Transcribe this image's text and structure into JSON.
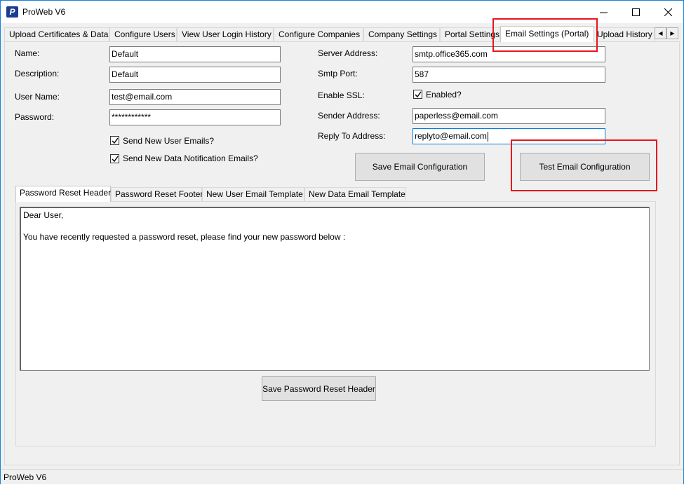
{
  "window": {
    "title": "ProWeb V6",
    "icon": "proweb-logo-icon"
  },
  "tabs": [
    {
      "label": "Upload Certificates & Data"
    },
    {
      "label": "Configure Users"
    },
    {
      "label": "View User Login History"
    },
    {
      "label": "Configure Companies"
    },
    {
      "label": "Company Settings"
    },
    {
      "label": "Portal Settings"
    },
    {
      "label": "Email Settings (Portal)"
    },
    {
      "label": "Upload History"
    }
  ],
  "form_left": {
    "name_label": "Name:",
    "name_value": "Default",
    "description_label": "Description:",
    "description_value": "Default",
    "username_label": "User Name:",
    "username_value": "test@email.com",
    "password_label": "Password:",
    "password_value": "************",
    "send_new_user_label": "Send New User Emails?",
    "send_new_data_label": "Send New Data Notification Emails?"
  },
  "form_right": {
    "server_label": "Server Address:",
    "server_value": "smtp.office365.com",
    "port_label": "Smtp Port:",
    "port_value": "587",
    "ssl_label": "Enable SSL:",
    "ssl_checkbox_label": "Enabled?",
    "sender_label": "Sender Address:",
    "sender_value": "paperless@email.com",
    "reply_label": "Reply To Address:",
    "reply_value": "replyto@email.com"
  },
  "buttons": {
    "save_email": "Save Email Configuration",
    "test_email": "Test Email Configuration",
    "save_header": "Save Password Reset Header"
  },
  "subtabs": [
    {
      "label": "Password Reset Header"
    },
    {
      "label": "Password Reset Footer"
    },
    {
      "label": "New User Email Template"
    },
    {
      "label": "New Data Email Template"
    }
  ],
  "editor": {
    "line1": "Dear User,",
    "line2": "You have recently requested a password reset, please find your new password below :"
  },
  "status": {
    "text": "ProWeb V6"
  },
  "colors": {
    "highlight": "#e8141b",
    "accent": "#0078d7"
  }
}
